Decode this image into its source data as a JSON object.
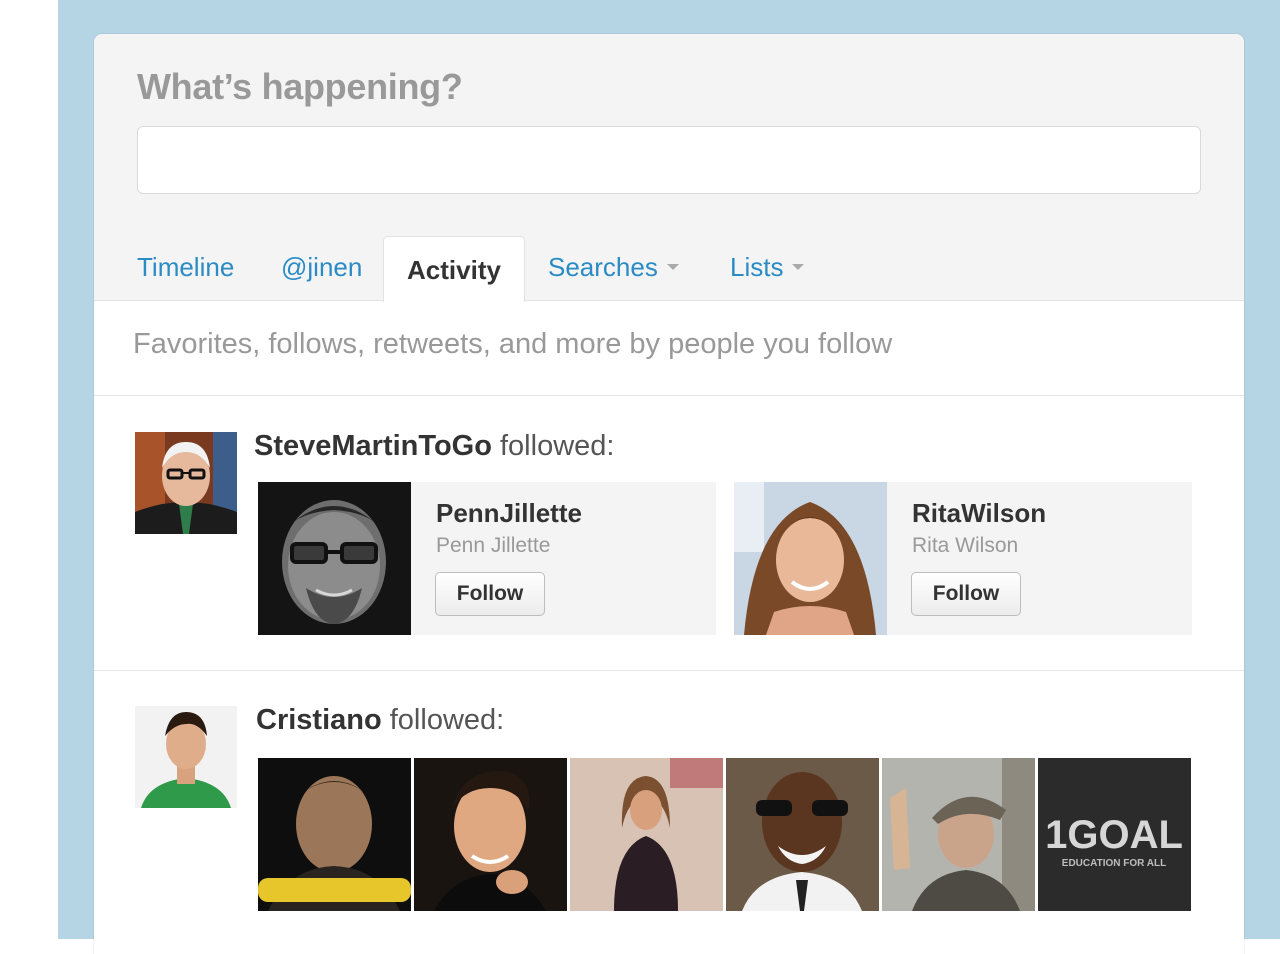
{
  "composer": {
    "prompt": "What’s happening?",
    "input_value": ""
  },
  "tabs": [
    {
      "label": "Timeline",
      "active": false,
      "has_dropdown": false
    },
    {
      "label": "@jinen",
      "active": false,
      "has_dropdown": false
    },
    {
      "label": "Activity",
      "active": true,
      "has_dropdown": false
    },
    {
      "label": "Searches",
      "active": false,
      "has_dropdown": true
    },
    {
      "label": "Lists",
      "active": false,
      "has_dropdown": true
    }
  ],
  "activity": {
    "subtitle": "Favorites, follows, retweets, and more by people you follow",
    "items": [
      {
        "actor": "SteveMartinToGo",
        "action": "followed:",
        "followed": [
          {
            "screen_name": "PennJillette",
            "real_name": "Penn Jillette",
            "button": "Follow"
          },
          {
            "screen_name": "RitaWilson",
            "real_name": "Rita Wilson",
            "button": "Follow"
          }
        ]
      },
      {
        "actor": "Cristiano",
        "action": "followed:",
        "followed_tiles": 6,
        "last_tile_text": {
          "big": "1GOAL",
          "small": "EDUCATION FOR ALL"
        }
      }
    ]
  },
  "colors": {
    "page_background": "#b5d5e5",
    "link": "#2a8bc5",
    "muted": "#999999"
  }
}
